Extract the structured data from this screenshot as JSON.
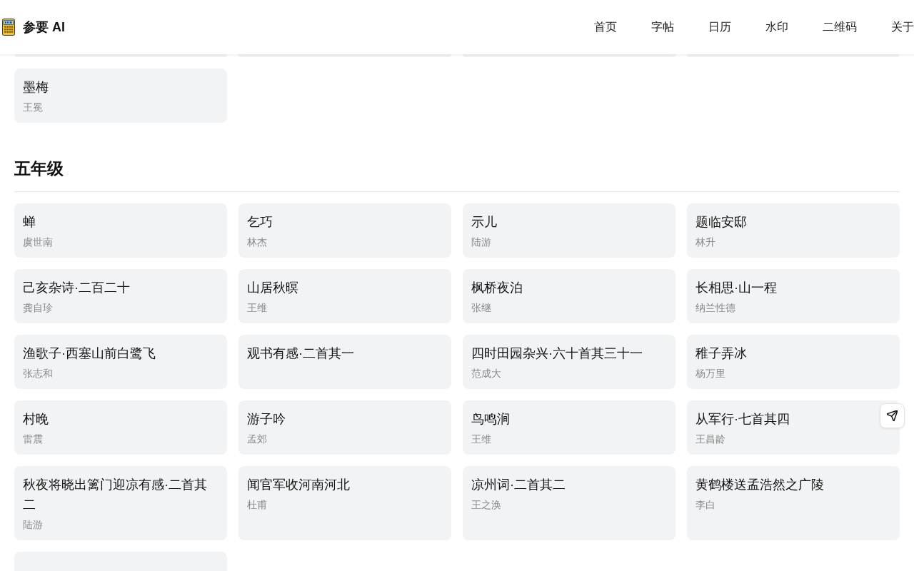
{
  "header": {
    "brand": "参要 AI",
    "nav": [
      "首页",
      "字帖",
      "日历",
      "水印",
      "二维码",
      "关于"
    ]
  },
  "sections": [
    {
      "cards": [
        {
          "kind": "edge_bottom"
        },
        {
          "kind": "edge_bottom"
        },
        {
          "kind": "edge_bottom"
        },
        {
          "kind": "edge_bottom"
        },
        {
          "kind": "poem",
          "title": "墨梅",
          "author": "王冕"
        }
      ]
    },
    {
      "heading": "五年级",
      "cards": [
        {
          "kind": "poem",
          "title": "蝉",
          "author": "虞世南"
        },
        {
          "kind": "poem",
          "title": "乞巧",
          "author": "林杰"
        },
        {
          "kind": "poem",
          "title": "示儿",
          "author": "陆游"
        },
        {
          "kind": "poem",
          "title": "题临安邸",
          "author": "林升"
        },
        {
          "kind": "poem",
          "title": "己亥杂诗·二百二十",
          "author": "龚自珍"
        },
        {
          "kind": "poem",
          "title": "山居秋暝",
          "author": "王维"
        },
        {
          "kind": "poem",
          "title": "枫桥夜泊",
          "author": "张继"
        },
        {
          "kind": "poem",
          "title": "长相思·山一程",
          "author": "纳兰性德"
        },
        {
          "kind": "poem",
          "title": "渔歌子·西塞山前白鹭飞",
          "author": "张志和"
        },
        {
          "kind": "poem",
          "title": "观书有感·二首其一"
        },
        {
          "kind": "poem",
          "title": "四时田园杂兴·六十首其三十一",
          "author": "范成大"
        },
        {
          "kind": "poem",
          "title": "稚子弄冰",
          "author": "杨万里"
        },
        {
          "kind": "poem",
          "title": "村晚",
          "author": "雷震"
        },
        {
          "kind": "poem",
          "title": "游子吟",
          "author": "孟郊"
        },
        {
          "kind": "poem",
          "title": "鸟鸣涧",
          "author": "王维"
        },
        {
          "kind": "poem",
          "title": "从军行·七首其四",
          "author": "王昌龄"
        },
        {
          "kind": "poem",
          "title": "秋夜将晓出篱门迎凉有感·二首其二",
          "author": "陆游"
        },
        {
          "kind": "poem",
          "title": "闻官军收河南河北",
          "author": "杜甫"
        },
        {
          "kind": "poem",
          "title": "凉州词·二首其二",
          "author": "王之涣"
        },
        {
          "kind": "poem",
          "title": "黄鹤楼送孟浩然之广陵",
          "author": "李白"
        },
        {
          "kind": "edge_top"
        }
      ]
    }
  ]
}
